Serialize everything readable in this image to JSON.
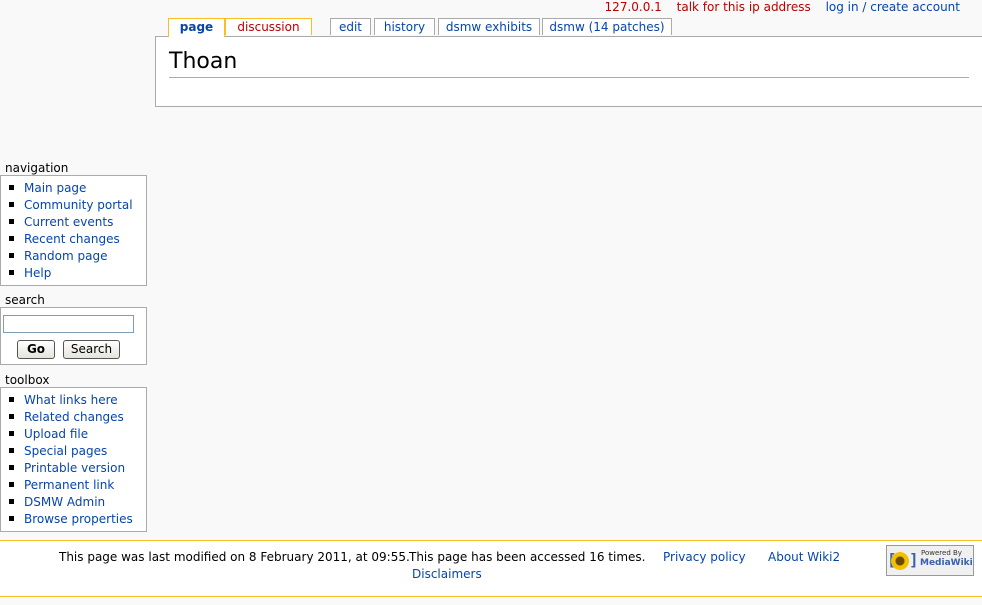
{
  "personal": {
    "ip": "127.0.0.1",
    "talk": "talk for this ip address",
    "login": "log in / create account"
  },
  "tabs": [
    "page",
    "discussion",
    "edit",
    "history",
    "dsmw exhibits",
    "dsmw (14 patches)"
  ],
  "heading": "Thoan",
  "navigation": {
    "title": "navigation",
    "items": [
      "Main page",
      "Community portal",
      "Current events",
      "Recent changes",
      "Random page",
      "Help"
    ]
  },
  "search": {
    "title": "search",
    "value": "",
    "go": "Go",
    "search": "Search"
  },
  "toolbox": {
    "title": "toolbox",
    "items": [
      "What links here",
      "Related changes",
      "Upload file",
      "Special pages",
      "Printable version",
      "Permanent link",
      "DSMW Admin",
      "Browse properties"
    ]
  },
  "footer": {
    "lastmod": "This page was last modified on 8 February 2011, at 09:55.",
    "viewcount": "This page has been accessed 16 times.",
    "privacy": "Privacy policy",
    "about": "About Wiki2",
    "disclaimers": "Disclaimers",
    "powered_top": "Powered By",
    "powered_main": "MediaWiki"
  },
  "colors": {
    "link": "#0645ad",
    "new_link": "#ba0000",
    "tab_accent": "#fabd23",
    "border": "#aaaaaa",
    "background": "#f9f9f9"
  }
}
